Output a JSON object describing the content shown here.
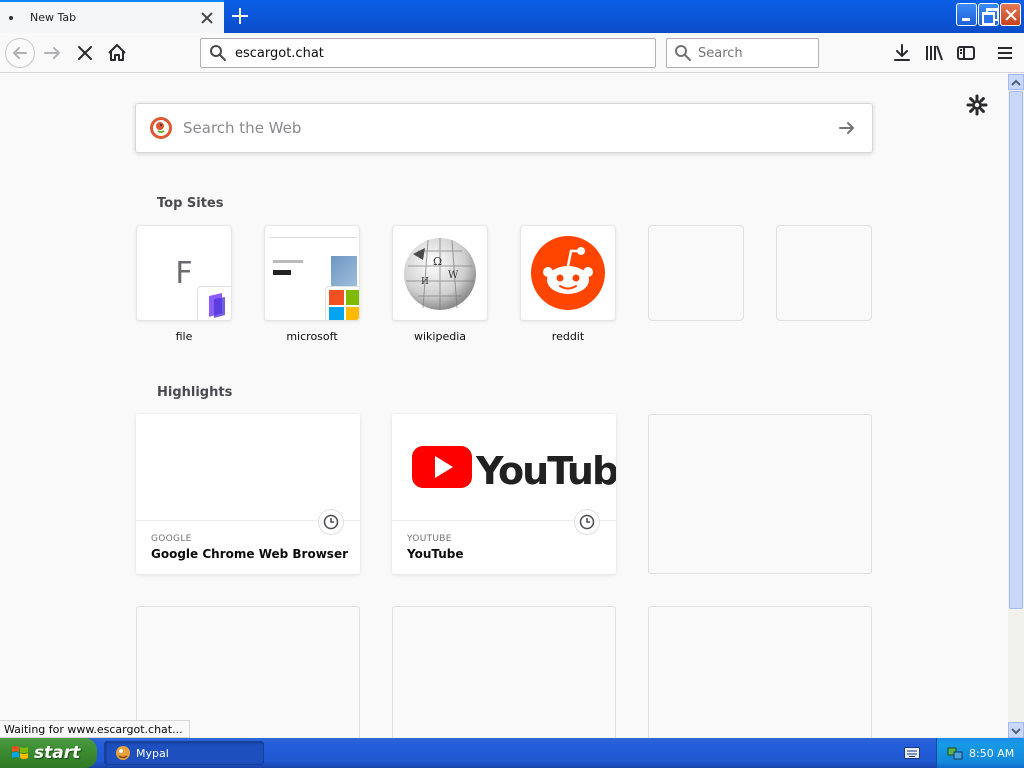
{
  "tab": {
    "title": "New Tab"
  },
  "toolbar": {
    "url": "escargot.chat",
    "search_placeholder": "Search"
  },
  "main_search": {
    "placeholder": "Search the Web"
  },
  "top_sites": {
    "title": "Top Sites",
    "items": [
      {
        "label": "file",
        "letter": "F"
      },
      {
        "label": "microsoft"
      },
      {
        "label": "wikipedia"
      },
      {
        "label": "reddit"
      },
      {
        "label": ""
      },
      {
        "label": ""
      }
    ]
  },
  "highlights": {
    "title": "Highlights",
    "cards": [
      {
        "source": "GOOGLE",
        "title": "Google Chrome Web Browser"
      },
      {
        "source": "YOUTUBE",
        "title": "YouTube",
        "logo_text": "YouTube"
      }
    ]
  },
  "status": {
    "text": "Waiting for www.escargot.chat..."
  },
  "taskbar": {
    "start_label": "start",
    "task": "Mypal",
    "clock": "8:50 AM"
  },
  "colors": {
    "accent": "#0a84ff",
    "reddit": "#ff4500",
    "youtube": "#ff0000",
    "taskbar": "#245edb",
    "start": "#3c8d31"
  },
  "icons": [
    "back-arrow-icon",
    "forward-arrow-icon",
    "stop-icon",
    "home-icon",
    "search-icon",
    "download-icon",
    "library-icon",
    "sidebar-icon",
    "menu-icon",
    "gear-icon",
    "duckduckgo-icon",
    "arrow-right-icon",
    "clock-icon",
    "windows-flag-icon",
    "keyboard-icon"
  ]
}
